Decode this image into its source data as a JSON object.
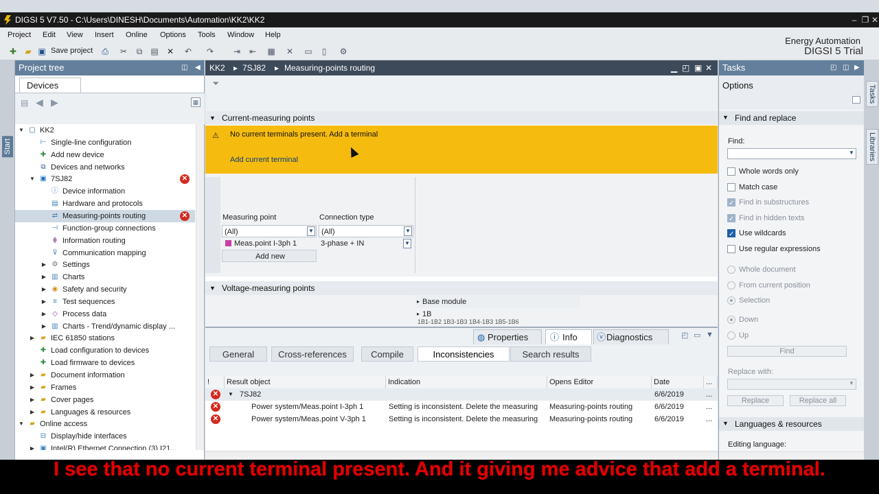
{
  "window": {
    "title": "DIGSI 5 V7.50 - C:\\Users\\DINESH\\Documents\\Automation\\KK2\\KK2"
  },
  "menu": [
    "Project",
    "Edit",
    "View",
    "Insert",
    "Online",
    "Options",
    "Tools",
    "Window",
    "Help"
  ],
  "toolbar": {
    "save_label": "Save project"
  },
  "brand": {
    "line1": "Energy Automation",
    "line2": "DIGSI 5 Trial"
  },
  "portal": {
    "start": "Start"
  },
  "project_tree": {
    "title": "Project tree",
    "tab": "Devices",
    "items": [
      {
        "label": "KK2",
        "icon": "project-icon"
      },
      {
        "label": "Single-line configuration",
        "icon": "single-line-icon"
      },
      {
        "label": "Add new device",
        "icon": "add-device-icon"
      },
      {
        "label": "Devices and networks",
        "icon": "network-icon"
      },
      {
        "label": "7SJ82",
        "icon": "device-icon"
      },
      {
        "label": "Device information",
        "icon": "info-icon"
      },
      {
        "label": "Hardware and protocols",
        "icon": "hardware-icon"
      },
      {
        "label": "Measuring-points routing",
        "icon": "routing-icon"
      },
      {
        "label": "Function-group connections",
        "icon": "connections-icon"
      },
      {
        "label": "Information routing",
        "icon": "info-routing-icon"
      },
      {
        "label": "Communication mapping",
        "icon": "communication-icon"
      },
      {
        "label": "Settings",
        "icon": "settings-icon"
      },
      {
        "label": "Charts",
        "icon": "charts-icon"
      },
      {
        "label": "Safety and security",
        "icon": "security-icon"
      },
      {
        "label": "Test sequences",
        "icon": "test-icon"
      },
      {
        "label": "Process data",
        "icon": "process-icon"
      },
      {
        "label": "Charts - Trend/dynamic display ...",
        "icon": "trend-icon"
      },
      {
        "label": "IEC 61850 stations",
        "icon": "folder-icon"
      },
      {
        "label": "Load configuration to devices",
        "icon": "load-config-icon"
      },
      {
        "label": "Load firmware to devices",
        "icon": "load-firmware-icon"
      },
      {
        "label": "Document information",
        "icon": "folder-icon"
      },
      {
        "label": "Frames",
        "icon": "folder-icon"
      },
      {
        "label": "Cover pages",
        "icon": "folder-icon"
      },
      {
        "label": "Languages & resources",
        "icon": "languages-icon"
      },
      {
        "label": "Online access",
        "icon": "folder-icon"
      },
      {
        "label": "Display/hide interfaces",
        "icon": "interfaces-icon"
      },
      {
        "label": "Intel(R) Ethernet Connection (3) I21...",
        "icon": "ethernet-icon"
      }
    ]
  },
  "editor": {
    "breadcrumb": [
      "KK2",
      "7SJ82",
      "Measuring-points routing"
    ],
    "current_section": "Current-measuring points",
    "warning_text": "No current terminals present. Add a terminal",
    "warning_link": "Add current terminal",
    "grid": {
      "col_measuring_point": "Measuring point",
      "col_connection_type": "Connection type",
      "filter_all_1": "(All)",
      "filter_all_2": "(All)",
      "row_point": "Meas.point I-3ph 1",
      "row_type": "3-phase + IN",
      "add_new": "Add new"
    },
    "voltage_section": "Voltage-measuring points",
    "base_module": "Base module",
    "slot": "1B",
    "terminal_row": "1B1-1B2   1B3-1B3   1B4-1B3   1B5-1B6"
  },
  "inspector": {
    "tabs": [
      "Properties",
      "Info",
      "Diagnostics"
    ],
    "subtabs": [
      "General",
      "Cross-references",
      "Compile",
      "Inconsistencies",
      "Search results"
    ],
    "columns": [
      "Result object",
      "Indication",
      "Opens Editor",
      "Date"
    ],
    "rows": [
      {
        "object": "7SJ82",
        "indication": "",
        "editor": "",
        "date": "6/6/2019"
      },
      {
        "object": "Power system/Meas.point I-3ph 1",
        "indication": "Setting is inconsistent. Delete the measuring",
        "editor": "Measuring-points routing",
        "date": "6/6/2019"
      },
      {
        "object": "Power system/Meas.point V-3ph 1",
        "indication": "Setting is inconsistent. Delete the measuring",
        "editor": "Measuring-points routing",
        "date": "6/6/2019"
      }
    ],
    "more": "..."
  },
  "tasks": {
    "title": "Tasks",
    "options": "Options",
    "find_replace": "Find and replace",
    "find_label": "Find:",
    "checkboxes": [
      {
        "label": "Whole words only",
        "checked": false,
        "disabled": false
      },
      {
        "label": "Match case",
        "checked": false,
        "disabled": false
      },
      {
        "label": "Find in substructures",
        "checked": true,
        "disabled": true
      },
      {
        "label": "Find in hidden texts",
        "checked": true,
        "disabled": true
      },
      {
        "label": "Use wildcards",
        "checked": true,
        "disabled": false
      },
      {
        "label": "Use regular expressions",
        "checked": false,
        "disabled": false
      }
    ],
    "radios1": [
      "Whole document",
      "From current position",
      "Selection"
    ],
    "radios2": [
      "Down",
      "Up"
    ],
    "find_button": "Find",
    "replace_with": "Replace with:",
    "replace_button": "Replace",
    "replace_all_button": "Replace all",
    "languages": "Languages & resources",
    "editing_language": "Editing language:",
    "side_tabs": [
      "Tasks",
      "Libraries"
    ]
  },
  "subtitle": "I see that no current terminal present. And it giving me advice that add a terminal."
}
